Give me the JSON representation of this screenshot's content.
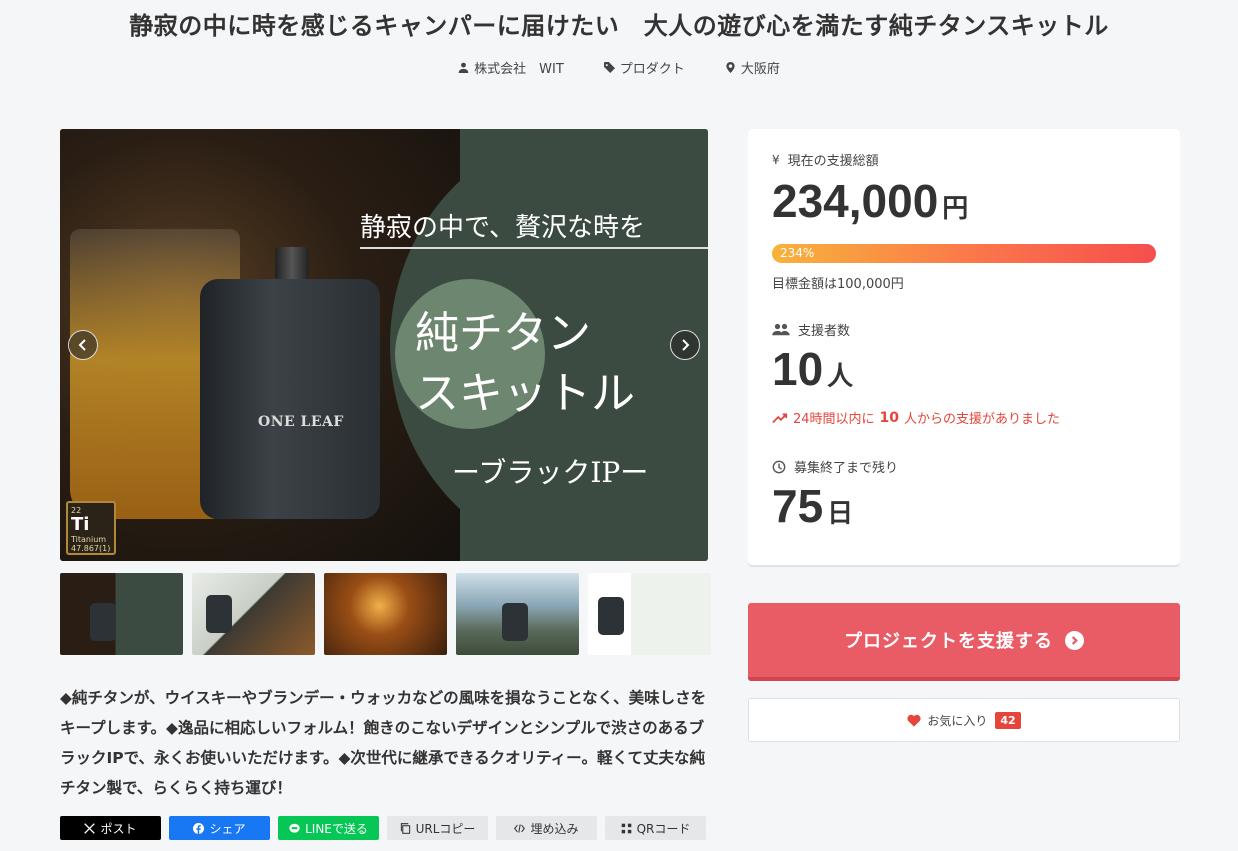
{
  "title": "静寂の中に時を感じるキャンパーに届けたい　大人の遊び心を満たす純チタンスキットル",
  "meta": {
    "owner": "株式会社　WIT",
    "category": "プロダクト",
    "location": "大阪府"
  },
  "hero_image": {
    "text_top": "静寂の中で、贅沢な時を",
    "text_big_line1": "純チタン",
    "text_big_line2": "スキットル",
    "text_sub": "ーブラックIPー",
    "brand": "ONE LEAF",
    "element_number": "22",
    "element_symbol": "Ti",
    "element_name": "Titanium",
    "element_mass": "47.867(1)"
  },
  "thumbnails_count": 5,
  "description": "◆純チタンが、ウイスキーやブランデー・ウォッカなどの風味を損なうことなく、美味しさをキープします。◆逸品に相応しいフォルム！飽きのこないデザインとシンプルで渋さのあるブラックIPで、永くお使いいただけます。◆次世代に継承できるクオリティー。軽くて丈夫な純チタン製で、らくらく持ち運び！",
  "share": {
    "x": "ポスト",
    "facebook": "シェア",
    "line": "LINEで送る",
    "url_copy": "URLコピー",
    "embed": "埋め込み",
    "qr": "QRコード"
  },
  "stats": {
    "total_label": "現在の支援総額",
    "total_amount": "234,000",
    "total_unit": "円",
    "progress_text": "234%",
    "progress_percent": 234,
    "goal_text": "目標金額は100,000円",
    "supporters_label": "支援者数",
    "supporters_count": "10",
    "supporters_unit": "人",
    "recent_prefix": "24時間以内に",
    "recent_count": "10",
    "recent_suffix": "人からの支援がありました",
    "remaining_label": "募集終了まで残り",
    "remaining_days": "75",
    "remaining_unit": "日"
  },
  "support_button": "プロジェクトを支援する",
  "favorite": {
    "label": "お気に入り",
    "count": "42"
  },
  "colors": {
    "support": "#e95c66",
    "accent_red": "#e5453b",
    "progress_start": "#f7b33b",
    "progress_end": "#f64e4e"
  }
}
